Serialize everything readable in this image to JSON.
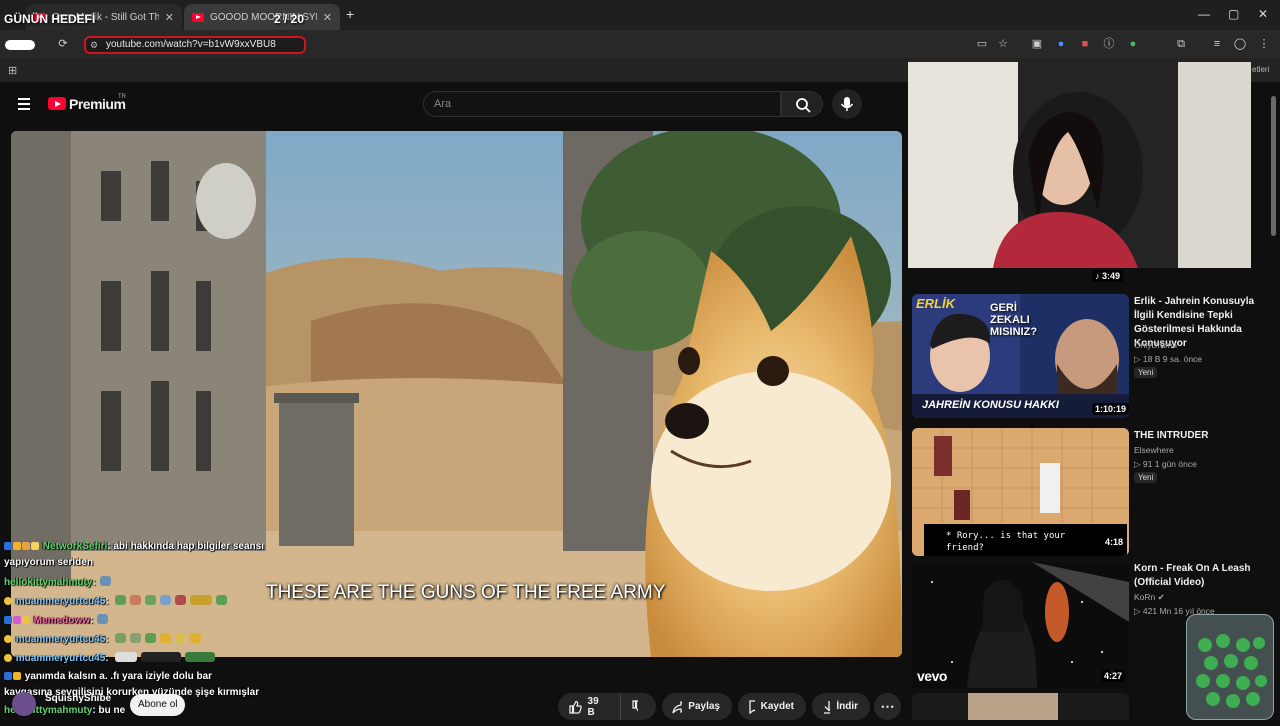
{
  "browser": {
    "tabs": [
      {
        "title": "Gym Musik - Still Got The Blues"
      },
      {
        "title": "GOOOD MOORNIN SYRIA"
      }
    ],
    "new_tab": "+",
    "url": "youtube.com/watch?v=b1vW9xxVBU8",
    "window_controls": {
      "minimize": "—",
      "maximize": "▢",
      "close": "✕"
    },
    "bookmark_fragment": "etleri"
  },
  "overlay": {
    "goal_label": "GÜNÜN HEDEFİ",
    "goal_count": "2 / 20"
  },
  "youtube": {
    "brand": "Premium",
    "country": "TR",
    "search_placeholder": "Ara",
    "subtitle": "THESE ARE THE GUNS OF THE FREE ARMY",
    "channel_name": "SquishyShibe",
    "subscribe": "Abone ol",
    "actions": {
      "like_count": "39 B",
      "share": "Paylaş",
      "save": "Kaydet",
      "download": "İndir",
      "more": "⋯"
    }
  },
  "chat": [
    {
      "user": "NetworkSefiri",
      "message": ": abi hakkında hap bilgiler seansı"
    },
    {
      "user": "",
      "message": "yapıyorum seriden"
    },
    {
      "user": "hellokittymahmuty",
      "message": ":"
    },
    {
      "user": "muammeryurtcu45",
      "message": ":"
    },
    {
      "user": "Memedoww",
      "message": ":"
    },
    {
      "user": "muammeryurtcu45",
      "message": ":"
    },
    {
      "user": "muammeryurtcu45",
      "message": ":"
    },
    {
      "user": "",
      "message": "yanımda kalsın a. .fı yara iziyle dolu bar"
    },
    {
      "user": "",
      "message": "kavgasına sevgilisini korurken yüzünde şişe kırmışlar"
    },
    {
      "user": "hellokittymahmuty",
      "message": ": bu ne"
    }
  ],
  "webcam": {
    "vevo_label": "vevo",
    "duration": "3:49"
  },
  "recommendations": [
    {
      "title": "Erlik - Jahrein Konusuyla İlgili Kendisine Tepki Gösterilmesi Hakkında Konuşuyor",
      "channel": "OnlyDrama",
      "views": "18 B",
      "age": "9 sa. önce",
      "badge": "Yeni",
      "duration": "1:10:19",
      "thumb_text_top": "ERLİK",
      "thumb_text_q": "GERİ ZEKALI MISINIZ?",
      "thumb_text_bottom": "JAHREİN KONUSU HAKKI"
    },
    {
      "title": "THE INTRUDER",
      "channel": "Elsewhere",
      "views": "91",
      "age": "1 gün önce",
      "badge": "Yeni",
      "duration": "4:18",
      "dialogue": "* Rory... is that your friend?"
    },
    {
      "title": "Korn - Freak On A Leash (Official Video)",
      "channel": "KoRn",
      "views": "421 Mn",
      "age": "16 yıl önce",
      "duration": "4:27",
      "vevo_label": "vevo"
    }
  ],
  "colors": {
    "youtube_red": "#ff0033",
    "url_highlight": "#d0141d",
    "background": "#0f0f0f"
  }
}
